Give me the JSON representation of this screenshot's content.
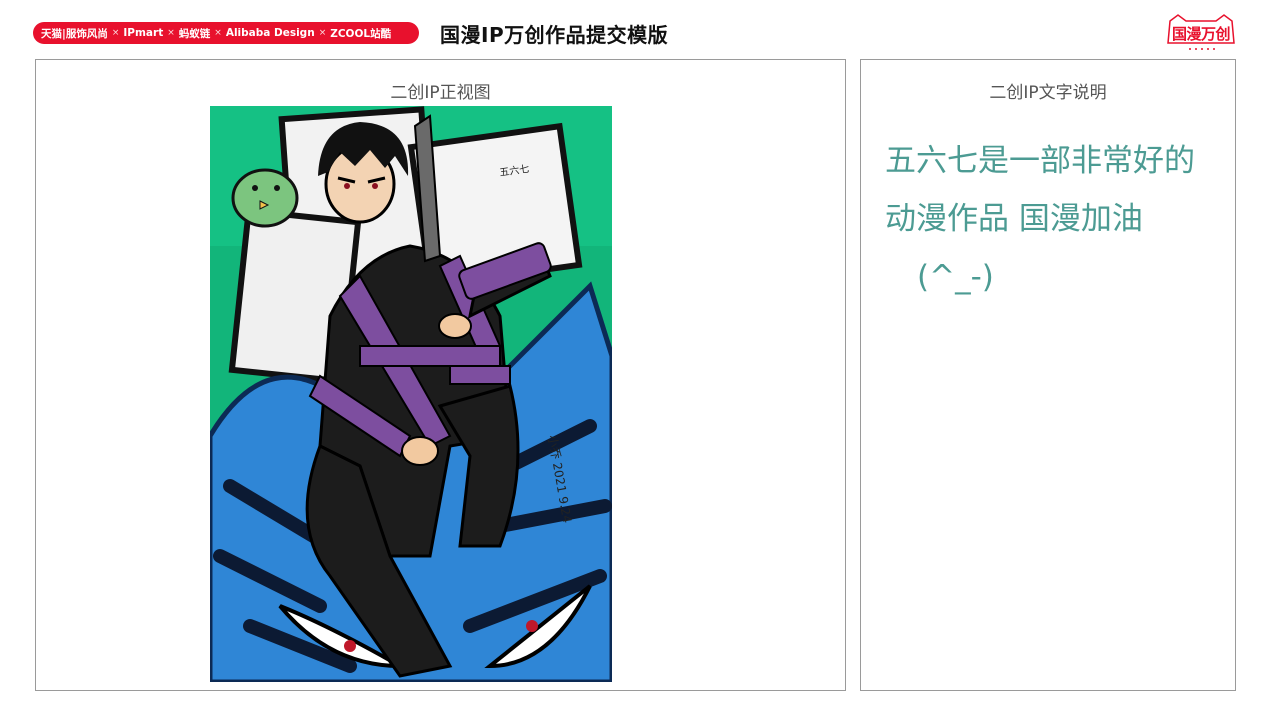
{
  "header": {
    "brands": [
      "天猫|服饰风尚",
      "IPmart",
      "蚂蚁链",
      "Alibaba Design",
      "ZCOOL站酷"
    ],
    "separator": "×",
    "title": "国漫IP万创作品提交模版",
    "logo_text": "国漫万创"
  },
  "left_panel": {
    "caption": "二创IP正视图",
    "artwork": {
      "signature": "小乔 2021 9.24",
      "inner_sign": "五六七"
    }
  },
  "right_panel": {
    "caption": "二创IP文字说明",
    "description_lines": [
      "五六七是一部非常好的",
      "动漫作品 国漫加油",
      "(^_-)"
    ]
  },
  "colors": {
    "brand_red": "#e8112d",
    "text_teal": "#4c9b93",
    "art_green": "#12b57a",
    "art_blue": "#2f86d6",
    "art_purple": "#7d4e9f"
  }
}
